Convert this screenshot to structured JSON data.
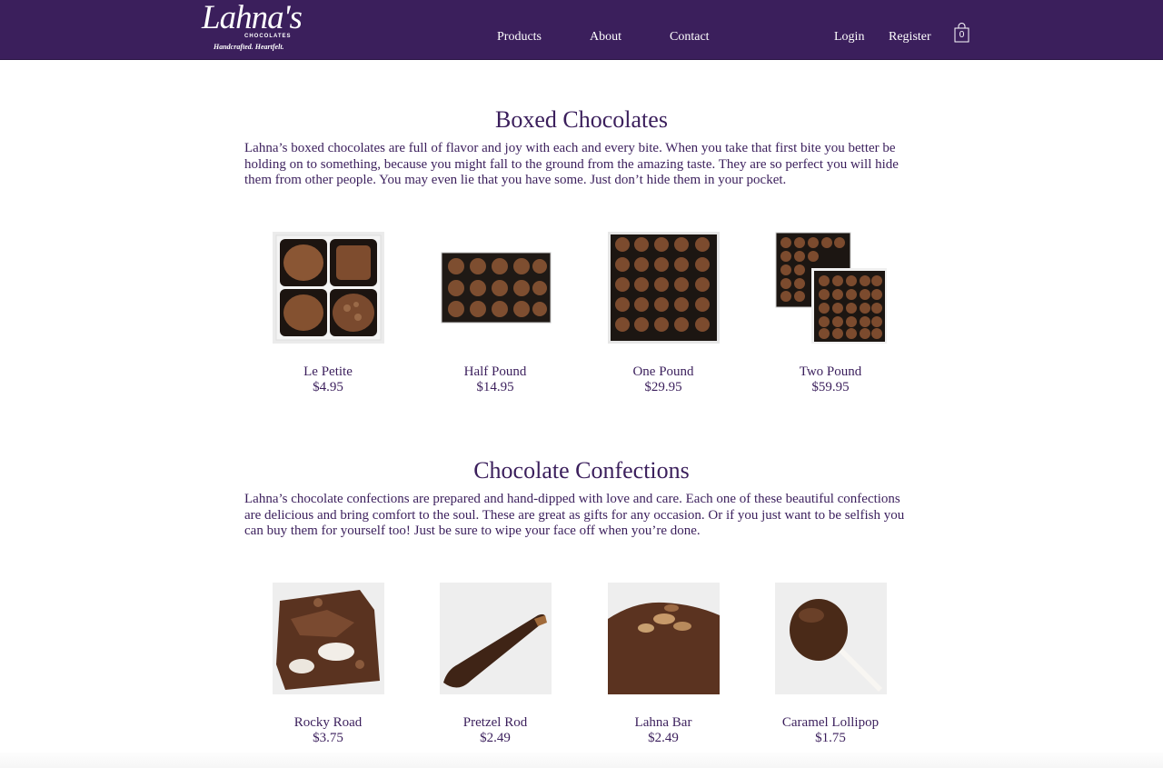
{
  "header": {
    "logo_main": "Lahna's",
    "logo_sub": "CHOCOLATES",
    "logo_tagline": "Handcrafted. Heartfelt.",
    "nav": [
      "Products",
      "About",
      "Contact"
    ],
    "login": "Login",
    "register": "Register",
    "cart_count": "0",
    "brand_color": "#3b1f5c"
  },
  "boxed": {
    "title": "Boxed Chocolates",
    "description": "Lahna’s boxed chocolates are full of flavor and joy with each and every bite. When you take that first bite you better be holding on to something, because you might fall to the ground from the amazing taste. They are so perfect you will hide them from other people. You may even lie that you have some. Just don’t hide them in your pocket.",
    "products": [
      {
        "name": "Le Petite",
        "price": "$4.95"
      },
      {
        "name": "Half Pound",
        "price": "$14.95"
      },
      {
        "name": "One Pound",
        "price": "$29.95"
      },
      {
        "name": "Two Pound",
        "price": "$59.95"
      }
    ]
  },
  "confections": {
    "title": "Chocolate Confections",
    "description": "Lahna’s chocolate confections are prepared and hand-dipped with love and care. Each one of these beautiful confections are delicious and bring comfort to the soul. These are great as gifts for any occasion. Or if you just want to be selfish you can buy them for yourself too! Just be sure to wipe your face off when you’re done.",
    "products": [
      {
        "name": "Rocky Road",
        "price": "$3.75"
      },
      {
        "name": "Pretzel Rod",
        "price": "$2.49"
      },
      {
        "name": "Lahna Bar",
        "price": "$2.49"
      },
      {
        "name": "Caramel Lollipop",
        "price": "$1.75"
      }
    ]
  }
}
